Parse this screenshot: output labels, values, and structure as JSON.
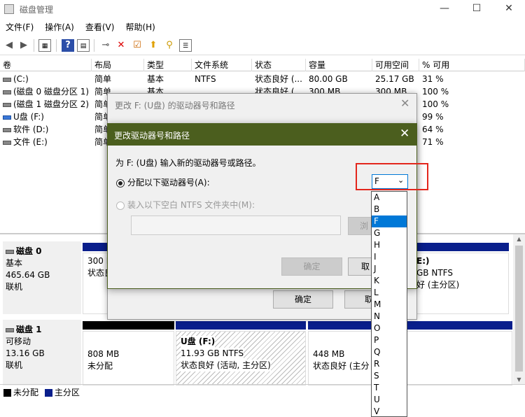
{
  "window": {
    "title": "磁盘管理",
    "minimize": "—",
    "maximize": "☐",
    "close": "✕"
  },
  "menu": [
    "文件(F)",
    "操作(A)",
    "查看(V)",
    "帮助(H)"
  ],
  "toolbar_icons": [
    "back-icon",
    "forward-icon",
    "console-tree-icon",
    "help-icon",
    "properties-icon",
    "connect-icon",
    "delete-icon",
    "check-icon",
    "up-icon",
    "find-icon",
    "list-icon"
  ],
  "volumes": {
    "headers": [
      "卷",
      "布局",
      "类型",
      "文件系统",
      "状态",
      "容量",
      "可用空间",
      "% 可用"
    ],
    "rows": [
      {
        "name": "(C:)",
        "layout": "简单",
        "type": "基本",
        "fs": "NTFS",
        "status": "状态良好 (...",
        "capacity": "80.00 GB",
        "free": "25.17 GB",
        "pct": "31 %",
        "usb": false
      },
      {
        "name": "(磁盘 0 磁盘分区 1)",
        "layout": "简单",
        "type": "基本",
        "fs": "",
        "status": "状态良好 (...",
        "capacity": "300 MB",
        "free": "300 MB",
        "pct": "100 %",
        "usb": false
      },
      {
        "name": "(磁盘 1 磁盘分区 2)",
        "layout": "简单",
        "type": "",
        "fs": "",
        "status": "",
        "capacity": "",
        "free": "",
        "pct": "100 %",
        "usb": false
      },
      {
        "name": "U盘 (F:)",
        "layout": "简单",
        "type": "",
        "fs": "",
        "status": "",
        "capacity": "",
        "free": "",
        "pct": "99 %",
        "usb": true
      },
      {
        "name": "软件 (D:)",
        "layout": "简单",
        "type": "",
        "fs": "",
        "status": "",
        "capacity": "",
        "free": "",
        "pct": "64 %",
        "usb": false
      },
      {
        "name": "文件 (E:)",
        "layout": "简单",
        "type": "",
        "fs": "",
        "status": "",
        "capacity": "",
        "free": "",
        "pct": "71 %",
        "usb": false
      }
    ]
  },
  "disks": {
    "disk0": {
      "name": "磁盘 0",
      "type": "基本",
      "size": "465.64 GB",
      "state": "联机",
      "p1": {
        "size": "300 M",
        "status": "状态良"
      },
      "p_right": {
        "line1": "E:)",
        "line2": "GB NTFS",
        "line3": "好 (主分区)"
      }
    },
    "disk1": {
      "name": "磁盘 1",
      "type": "可移动",
      "size": "13.16 GB",
      "state": "联机",
      "p1": {
        "size": "808 MB",
        "status": "未分配"
      },
      "p2": {
        "name": "U盘  (F:)",
        "size": "11.93 GB NTFS",
        "status": "状态良好 (活动, 主分区)"
      },
      "p3": {
        "size": "448 MB",
        "status": "状态良好 (主分"
      }
    }
  },
  "legend": {
    "unallocated": "未分配",
    "primary": "主分区",
    "unallocated_color": "#000000",
    "primary_color": "#0a1f8c"
  },
  "dialog_back": {
    "title": "更改 F: (U盘) 的驱动器号和路径",
    "ok": "确定",
    "cancel": "取"
  },
  "dialog_front": {
    "title": "更改驱动器号和路径",
    "prompt": "为 F: (U盘) 输入新的驱动器号或路径。",
    "opt_assign": "分配以下驱动器号(A):",
    "opt_mount": "装入以下空白 NTFS 文件夹中(M):",
    "browse": "浏",
    "ok": "确定",
    "cancel": "取",
    "selected_letter": "F"
  },
  "letters": [
    "A",
    "B",
    "F",
    "G",
    "H",
    "I",
    "J",
    "K",
    "L",
    "M",
    "N",
    "O",
    "P",
    "Q",
    "R",
    "S",
    "T",
    "U",
    "V"
  ],
  "colors": {
    "dialog_title_bg": "#4b5e1e",
    "highlight": "#0078d7",
    "annotation": "#e3261c"
  }
}
